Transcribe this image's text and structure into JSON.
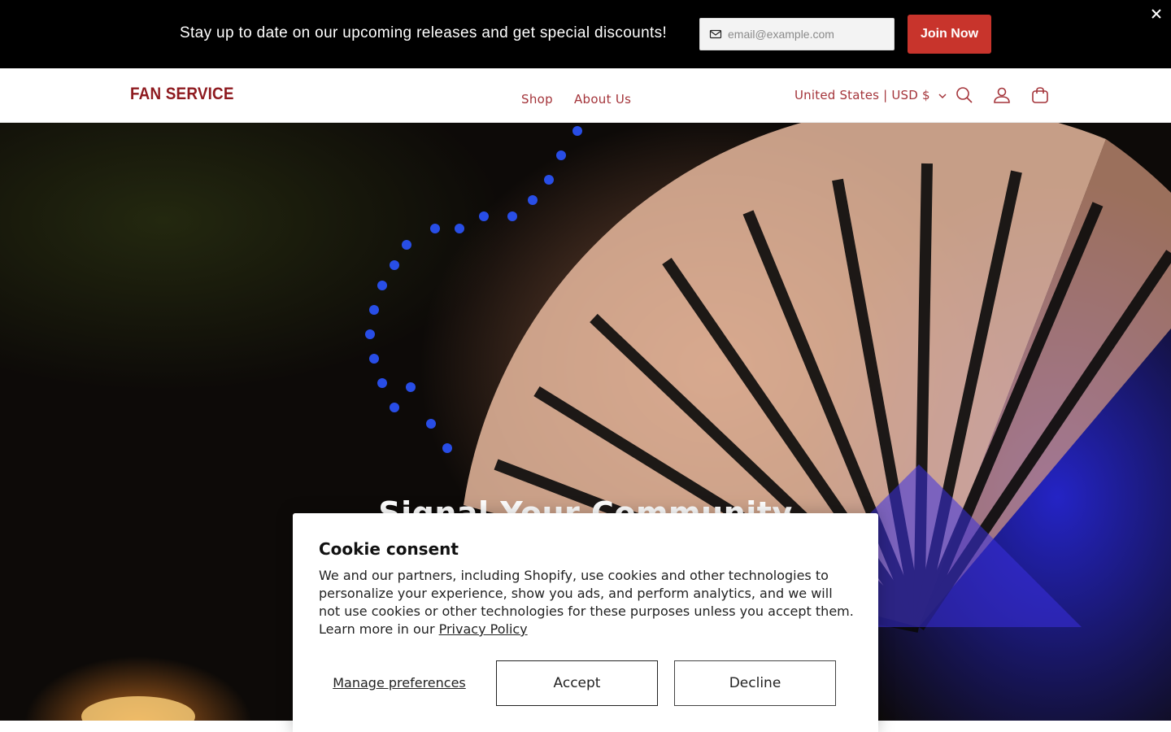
{
  "promo": {
    "text": "Stay up to date on our upcoming releases and get special discounts!",
    "email_placeholder": "email@example.com",
    "join_label": "Join Now",
    "close_glyph": "✕"
  },
  "header": {
    "logo": "FAN SERVICE",
    "nav": [
      {
        "label": "Shop"
      },
      {
        "label": "About Us"
      }
    ],
    "country_selector": "United States | USD $",
    "icons": [
      "search-icon",
      "account-icon",
      "cart-icon"
    ]
  },
  "hero": {
    "title": "Signal Your Community"
  },
  "cookie": {
    "title": "Cookie consent",
    "body": "We and our partners, including Shopify, use cookies and other technologies to personalize your experience, show you ads, and perform analytics, and we will not use cookies or other technologies for these purposes unless you accept them. Learn more in our ",
    "privacy_link": "Privacy Policy",
    "manage_label": "Manage preferences",
    "accept_label": "Accept",
    "decline_label": "Decline"
  },
  "colors": {
    "brand": "#8e1a1f",
    "nav": "#a4343a",
    "join_button": "#c8342c",
    "promo_bg": "#000000"
  }
}
